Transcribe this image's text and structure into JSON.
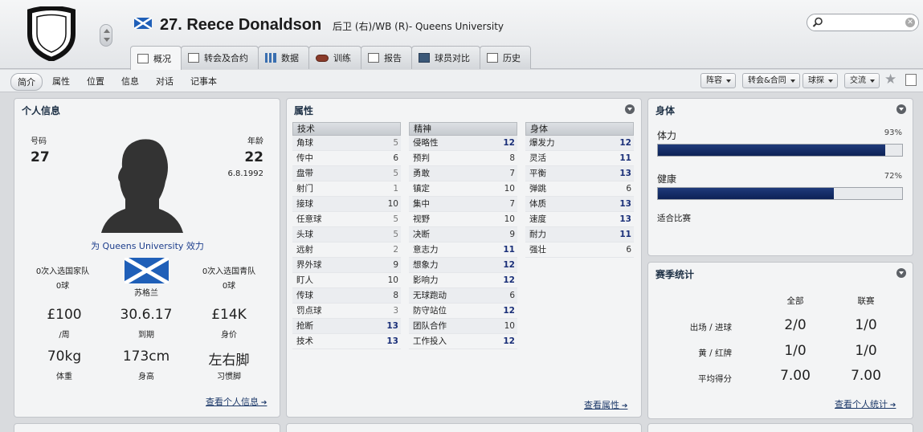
{
  "header": {
    "name": "27. Reece Donaldson",
    "position": "后卫 (右)/WB (R)- Queens University"
  },
  "tabs": [
    {
      "label": "概况",
      "icon": "profile-icon"
    },
    {
      "label": "转会及合约",
      "icon": "document-icon"
    },
    {
      "label": "数据",
      "icon": "bar-chart-icon"
    },
    {
      "label": "训练",
      "icon": "ball-icon"
    },
    {
      "label": "报告",
      "icon": "report-icon"
    },
    {
      "label": "球员对比",
      "icon": "compare-icon"
    },
    {
      "label": "历史",
      "icon": "history-icon"
    }
  ],
  "subnav": [
    "简介",
    "属性",
    "位置",
    "信息",
    "对话",
    "记事本"
  ],
  "toolbar": [
    "阵容",
    "转会&合同",
    "球探",
    "交流"
  ],
  "personal": {
    "title": "个人信息",
    "number_label": "号码",
    "number": "27",
    "age_label": "年龄",
    "age": "22",
    "dob": "6.8.1992",
    "plays_for": "为 Queens University 效力",
    "senior_caps": "0次入选国家队",
    "senior_goals": "0球",
    "youth_caps": "0次入选国青队",
    "youth_goals": "0球",
    "nation": "苏格兰",
    "wage": "£100",
    "wage_label": "/周",
    "expires": "30.6.17",
    "expires_label": "到期",
    "value": "£14K",
    "value_label": "身价",
    "weight": "70kg",
    "weight_label": "体重",
    "height": "173cm",
    "height_label": "身高",
    "foot": "左右脚",
    "foot_label": "习惯脚",
    "link": "查看个人信息"
  },
  "attributes": {
    "title": "属性",
    "link": "查看属性",
    "technical": {
      "header": "技术",
      "rows": [
        {
          "name": "角球",
          "value": 5
        },
        {
          "name": "传中",
          "value": 6
        },
        {
          "name": "盘带",
          "value": 5
        },
        {
          "name": "射门",
          "value": 1
        },
        {
          "name": "接球",
          "value": 10
        },
        {
          "name": "任意球",
          "value": 5
        },
        {
          "name": "头球",
          "value": 5
        },
        {
          "name": "远射",
          "value": 2
        },
        {
          "name": "界外球",
          "value": 9
        },
        {
          "name": "盯人",
          "value": 10
        },
        {
          "name": "传球",
          "value": 8
        },
        {
          "name": "罚点球",
          "value": 3
        },
        {
          "name": "抢断",
          "value": 13
        },
        {
          "name": "技术",
          "value": 13
        }
      ]
    },
    "mental": {
      "header": "精神",
      "rows": [
        {
          "name": "侵略性",
          "value": 12
        },
        {
          "name": "预判",
          "value": 8
        },
        {
          "name": "勇敢",
          "value": 7
        },
        {
          "name": "镇定",
          "value": 10
        },
        {
          "name": "集中",
          "value": 7
        },
        {
          "name": "视野",
          "value": 10
        },
        {
          "name": "决断",
          "value": 9
        },
        {
          "name": "意志力",
          "value": 11
        },
        {
          "name": "想象力",
          "value": 12
        },
        {
          "name": "影响力",
          "value": 12
        },
        {
          "name": "无球跑动",
          "value": 6
        },
        {
          "name": "防守站位",
          "value": 12
        },
        {
          "name": "团队合作",
          "value": 10
        },
        {
          "name": "工作投入",
          "value": 12
        }
      ]
    },
    "physical": {
      "header": "身体",
      "rows": [
        {
          "name": "爆发力",
          "value": 12
        },
        {
          "name": "灵活",
          "value": 11
        },
        {
          "name": "平衡",
          "value": 13
        },
        {
          "name": "弹跳",
          "value": 6
        },
        {
          "name": "体质",
          "value": 13
        },
        {
          "name": "速度",
          "value": 13
        },
        {
          "name": "耐力",
          "value": 11
        },
        {
          "name": "强壮",
          "value": 6
        }
      ]
    }
  },
  "body": {
    "title": "身体",
    "fitness_label": "体力",
    "fitness_pct": "93%",
    "fitness_value": 93,
    "health_label": "健康",
    "health_pct": "72%",
    "health_value": 72,
    "status": "适合比赛"
  },
  "season": {
    "title": "赛季统计",
    "col_all": "全部",
    "col_league": "联赛",
    "rows": [
      {
        "label": "出场 / 进球",
        "all": "2/0",
        "league": "1/0"
      },
      {
        "label": "黄 / 红牌",
        "all": "1/0",
        "league": "1/0"
      },
      {
        "label": "平均得分",
        "all": "7.00",
        "league": "7.00"
      }
    ],
    "link": "查看个人统计"
  },
  "colors": {
    "accent_navy": "#0d2256",
    "link_blue": "#1e3a6a",
    "flag_blue": "#1f5fb8"
  }
}
